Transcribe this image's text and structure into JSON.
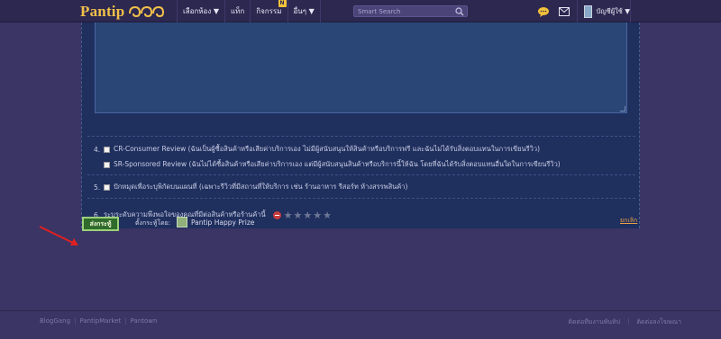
{
  "header": {
    "logo_text": "Pantip",
    "nav": [
      {
        "label": "เลือกห้อง ▼"
      },
      {
        "label": "แท็ก"
      },
      {
        "label": "กิจกรรม"
      },
      {
        "label": "อื่นๆ ▼"
      }
    ],
    "activity_badge": "N",
    "search_placeholder": "Smart Search",
    "account_label": "บัญชีผู้ใช้ ▼"
  },
  "form": {
    "option4": {
      "number": "4.",
      "items": [
        "CR-Consumer Review (ฉันเป็นผู้ซื้อสินค้าหรือเสียค่าบริการเอง ไม่มีผู้สนับสนุนให้สินค้าหรือบริการฟรี และฉันไม่ได้รับสิ่งตอบแทนในการเขียนรีวิว)",
        "SR-Sponsored Review (ฉันไม่ได้ซื้อสินค้าหรือเสียค่าบริการเอง แต่มีผู้สนับสนุนสินค้าหรือบริการนี้ให้ฉัน โดยที่ฉันได้รับสิ่งตอบแทนอื่นใดในการเขียนรีวิว)"
      ]
    },
    "option5": {
      "number": "5.",
      "label": "ปักหมุดเพื่อระบุพิกัดบนแผนที่ (เฉพาะรีวิวที่มีสถานที่ให้บริการ เช่น ร้านอาหาร รีสอร์ท ห้างสรรพสินค้า)"
    },
    "option6": {
      "number": "6.",
      "label": "ระบุระดับความพึงพอใจของคุณที่มีต่อสินค้าหรือร้านค้านี้",
      "rating": 0,
      "max_rating": 5
    }
  },
  "actions": {
    "submit_label": "ส่งกระทู้",
    "sender_label": "ตั้งกระทู้โดย:",
    "sender_name": "Pantip Happy Prize",
    "cancel_label": "ยกเลิก"
  },
  "footer": {
    "links_left": [
      "BlogGang",
      "PantipMarket",
      "Pantown"
    ],
    "links_right": [
      "ติดต่อทีมงานพันทิป",
      "ติดต่อลงโฆษณา"
    ]
  },
  "colors": {
    "background": "#3a3565",
    "panel": "#1f2f5e",
    "logo": "#f2c14a",
    "submit": "#2f6b2b",
    "annotation_arrow": "#e02020"
  }
}
